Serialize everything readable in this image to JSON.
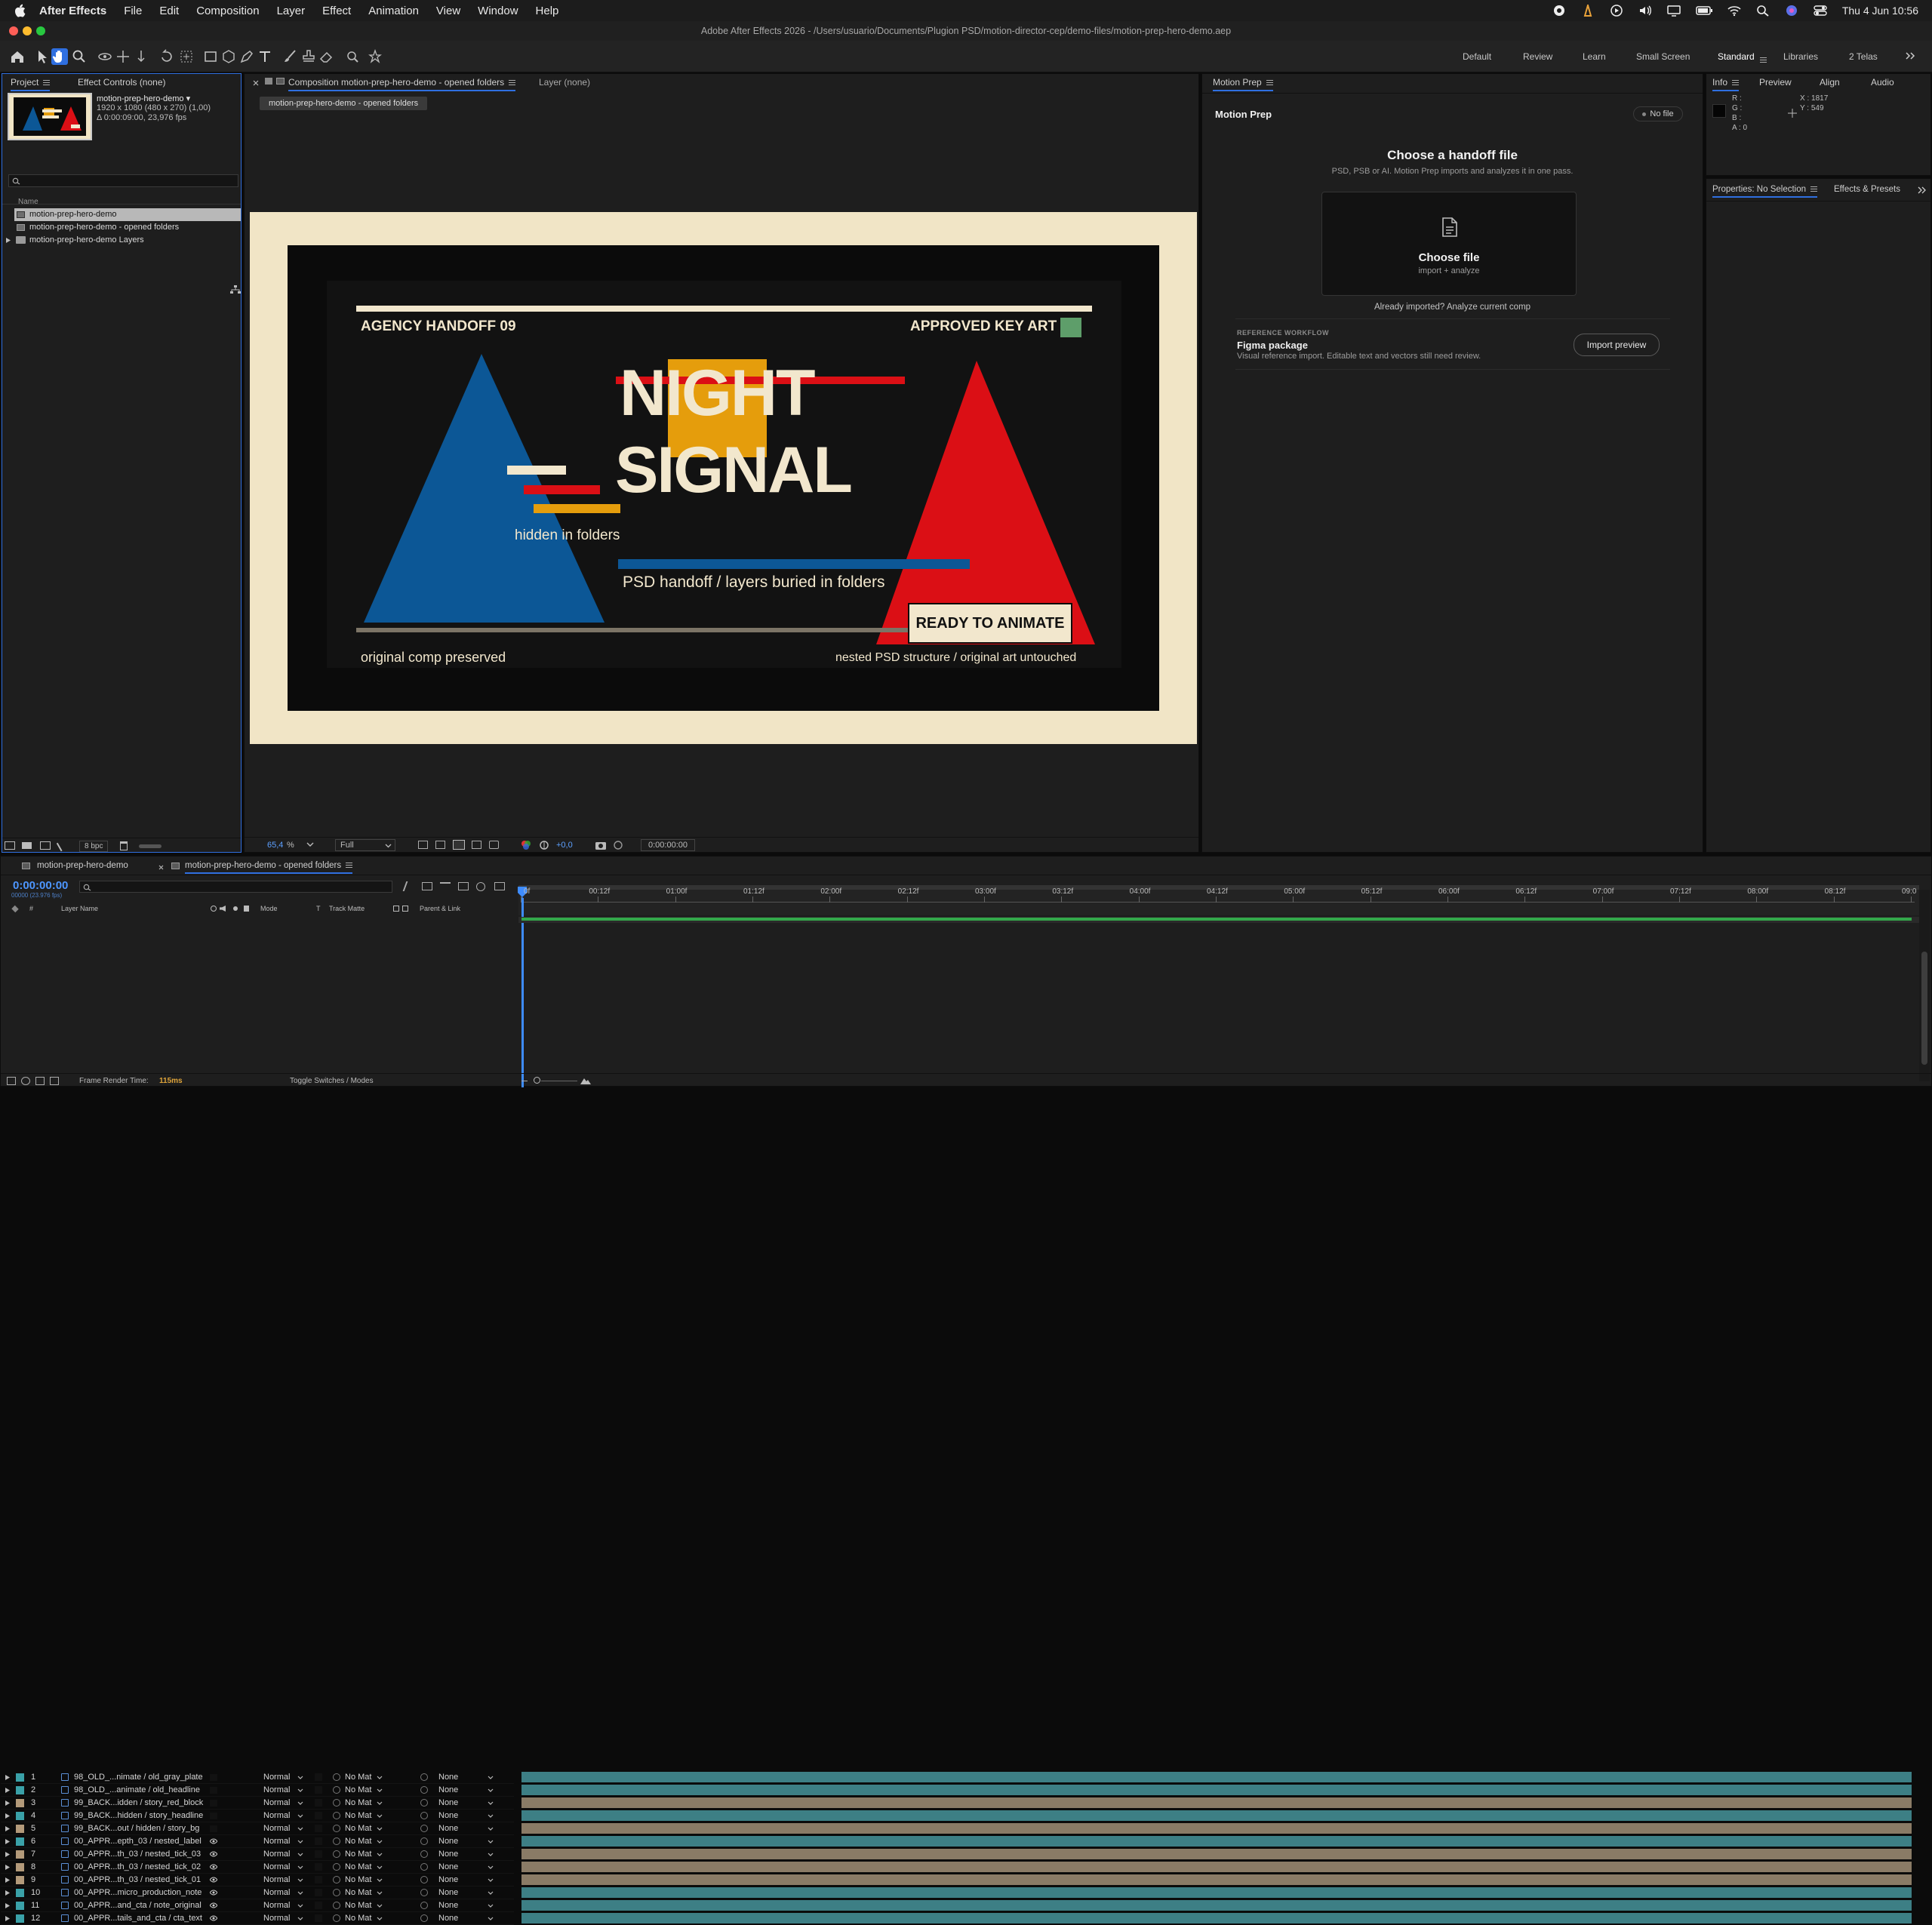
{
  "menubar": {
    "app_name": "After Effects",
    "items": [
      "File",
      "Edit",
      "Composition",
      "Layer",
      "Effect",
      "Animation",
      "View",
      "Window",
      "Help"
    ],
    "clock": "Thu 4 Jun  10:56"
  },
  "window": {
    "title": "Adobe After Effects 2026 - /Users/usuario/Documents/Plugion PSD/motion-director-cep/demo-files/motion-prep-hero-demo.aep"
  },
  "workspaces": [
    "Default",
    "Review",
    "Learn",
    "Small Screen",
    "Standard",
    "Libraries",
    "2 Telas"
  ],
  "active_workspace": "Standard",
  "project_panel": {
    "tab_project": "Project",
    "tab_effect_controls": "Effect Controls (none)",
    "selected_name": "motion-prep-hero-demo ▾",
    "selected_details_1": "1920 x 1080  (480 x 270) (1,00)",
    "selected_details_2": "Δ 0:00:09:00, 23,976 fps",
    "column_name": "Name",
    "items": [
      "motion-prep-hero-demo",
      "motion-prep-hero-demo - opened folders",
      "motion-prep-hero-demo Layers"
    ],
    "bpc": "8 bpc"
  },
  "comp_panel": {
    "tab_label": "Composition motion-prep-hero-demo - opened folders",
    "layer_tab": "Layer (none)",
    "breadcrumb": "motion-prep-hero-demo - opened folders",
    "zoom": "65,4",
    "zoom_unit": "%",
    "resolution": "Full",
    "exposure": "+0,0",
    "timecode": "0:00:00:00"
  },
  "artwork": {
    "top_left": "AGENCY HANDOFF 09",
    "top_right": "APPROVED KEY ART",
    "title_1": "NIGHT",
    "title_2": "SIGNAL",
    "hidden_label": "hidden in folders",
    "psd_label": "PSD handoff / layers buried in folders",
    "cta": "READY TO ANIMATE",
    "bottom_left": "original comp preserved",
    "bottom_right": "nested PSD structure / original art untouched",
    "colors": {
      "cream": "#f1e5c6",
      "black": "#0b0b0b",
      "blue": "#0c5796",
      "red": "#db0f15",
      "yellow": "#e59d0c",
      "green": "#5e9e6a",
      "text": "#f2e7cd"
    }
  },
  "motion_prep": {
    "tab": "Motion Prep",
    "title": "Motion Prep",
    "no_file": "No file",
    "heading": "Choose a handoff file",
    "subheading": "PSD, PSB or AI. Motion Prep imports and analyzes it in one pass.",
    "drop_title": "Choose file",
    "drop_sub": "import + analyze",
    "analyze_link": "Already imported? Analyze current comp",
    "ref_label": "REFERENCE WORKFLOW",
    "ref_title": "Figma package",
    "ref_desc": "Visual reference import. Editable text and vectors still need review.",
    "import_btn": "Import preview"
  },
  "info_panel": {
    "tabs": [
      "Info",
      "Preview",
      "Align",
      "Audio"
    ],
    "r": "R :",
    "g": "G :",
    "b": "B :",
    "a": "A :  0",
    "x": "X : 1817",
    "y": "Y : 549"
  },
  "properties_panel": {
    "tab": "Properties: No Selection",
    "tab2": "Effects & Presets"
  },
  "timeline": {
    "tab1": "motion-prep-hero-demo",
    "tab2": "motion-prep-hero-demo - opened folders",
    "timecode": "0:00:00:00",
    "timecode_sub": "00000 (23.976 fps)",
    "col_layer_name": "Layer Name",
    "col_mode": "Mode",
    "col_t": "T",
    "col_track_matte": "Track Matte",
    "col_parent": "Parent & Link",
    "ruler": [
      "0f",
      "00:12f",
      "01:00f",
      "01:12f",
      "02:00f",
      "02:12f",
      "03:00f",
      "03:12f",
      "04:00f",
      "04:12f",
      "05:00f",
      "05:12f",
      "06:00f",
      "06:12f",
      "07:00f",
      "07:12f",
      "08:00f",
      "08:12f",
      "09:0"
    ],
    "layers": [
      {
        "num": "1",
        "name": "98_OLD_...nimate / old_gray_plate",
        "mode": "Normal",
        "matte": "No Mat",
        "parent": "None",
        "color": "#3aa1a8",
        "eye": false
      },
      {
        "num": "2",
        "name": "98_OLD_...animate / old_headline",
        "mode": "Normal",
        "matte": "No Mat",
        "parent": "None",
        "color": "#3aa1a8",
        "eye": false
      },
      {
        "num": "3",
        "name": "99_BACK...idden / story_red_block",
        "mode": "Normal",
        "matte": "No Mat",
        "parent": "None",
        "color": "#b39a7a",
        "eye": false
      },
      {
        "num": "4",
        "name": "99_BACK...hidden / story_headline",
        "mode": "Normal",
        "matte": "No Mat",
        "parent": "None",
        "color": "#3aa1a8",
        "eye": false
      },
      {
        "num": "5",
        "name": "99_BACK...out / hidden / story_bg",
        "mode": "Normal",
        "matte": "No Mat",
        "parent": "None",
        "color": "#b39a7a",
        "eye": false
      },
      {
        "num": "6",
        "name": "00_APPR...epth_03 / nested_label",
        "mode": "Normal",
        "matte": "No Mat",
        "parent": "None",
        "color": "#3aa1a8",
        "eye": true
      },
      {
        "num": "7",
        "name": "00_APPR...th_03 / nested_tick_03",
        "mode": "Normal",
        "matte": "No Mat",
        "parent": "None",
        "color": "#b39a7a",
        "eye": true
      },
      {
        "num": "8",
        "name": "00_APPR...th_03 / nested_tick_02",
        "mode": "Normal",
        "matte": "No Mat",
        "parent": "None",
        "color": "#b39a7a",
        "eye": true
      },
      {
        "num": "9",
        "name": "00_APPR...th_03 / nested_tick_01",
        "mode": "Normal",
        "matte": "No Mat",
        "parent": "None",
        "color": "#b39a7a",
        "eye": true
      },
      {
        "num": "10",
        "name": "00_APPR...micro_production_note",
        "mode": "Normal",
        "matte": "No Mat",
        "parent": "None",
        "color": "#3aa1a8",
        "eye": true
      },
      {
        "num": "11",
        "name": "00_APPR...and_cta / note_original",
        "mode": "Normal",
        "matte": "No Mat",
        "parent": "None",
        "color": "#3aa1a8",
        "eye": true
      },
      {
        "num": "12",
        "name": "00_APPR...tails_and_cta / cta_text",
        "mode": "Normal",
        "matte": "No Mat",
        "parent": "None",
        "color": "#3aa1a8",
        "eye": true
      }
    ],
    "footer_label": "Frame Render Time:",
    "footer_value": "115ms",
    "toggle": "Toggle Switches / Modes"
  }
}
